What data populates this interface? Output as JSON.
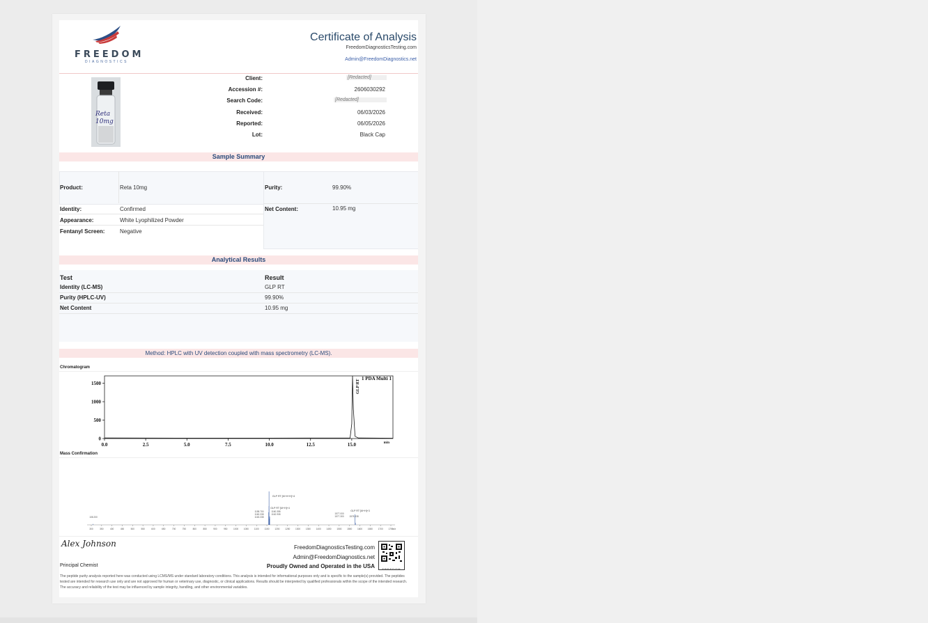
{
  "header": {
    "logo_word": "FREEDOM",
    "logo_sub": "DIAGNOSTICS",
    "title": "Certificate of Analysis",
    "website": "FreedomDiagnosticsTesting.com",
    "email": "Admin@FreedomDiagnostics.net"
  },
  "vial": {
    "label": "Reta 10mg"
  },
  "meta": [
    {
      "label": "Client:",
      "value": "[Redacted]",
      "redacted": true
    },
    {
      "label": "Accession #:",
      "value": "2606030292",
      "redacted": false
    },
    {
      "label": "Search Code:",
      "value": "[Redacted]",
      "redacted": true
    },
    {
      "label": "Received:",
      "value": "06/03/2026",
      "redacted": false
    },
    {
      "label": "Reported:",
      "value": "06/05/2026",
      "redacted": false
    },
    {
      "label": "Lot:",
      "value": "Black Cap",
      "redacted": false
    }
  ],
  "sample_summary": {
    "heading": "Sample Summary",
    "product_label": "Product:",
    "product": "Reta 10mg",
    "purity_label": "Purity:",
    "purity": "99.90%",
    "identity_label": "Identity:",
    "identity": "Confirmed",
    "net_label": "Net Content:",
    "net": "10.95 mg",
    "appearance_label": "Appearance:",
    "appearance": "White Lyophilized Powder",
    "fentanyl_label": "Fentanyl Screen:",
    "fentanyl": "Negative"
  },
  "analytical": {
    "heading": "Analytical Results",
    "col_test": "Test",
    "col_result": "Result",
    "rows": [
      {
        "test": "Identity (LC-MS)",
        "result": "GLP RT"
      },
      {
        "test": "Purity (HPLC-UV)",
        "result": "99.90%"
      },
      {
        "test": "Net Content",
        "result": "10.95 mg"
      }
    ]
  },
  "method": "Method: HPLC with UV detection coupled with mass spectrometry (LC-MS).",
  "chromatogram": {
    "label": "Chromatogram",
    "detector_label": "1 PDA Multi 1",
    "peak_label": "GLP RT"
  },
  "mass": {
    "label": "Mass Confirmation",
    "ion_labels": [
      "GLP RT [M+H+H]+4",
      "GLP RT [M+H]+4",
      "GLP RT [M+H]+3"
    ],
    "peak_labels": [
      "1158.700",
      "1160.338",
      "1163.338",
      "1160.358",
      "1162.908",
      "1577.000",
      "1577.300",
      "1578.438",
      "108.200"
    ],
    "axis_unit": "m/z"
  },
  "chart_data": [
    {
      "type": "line",
      "title": "",
      "xlabel": "min",
      "ylabel": "",
      "xlim": [
        0,
        17.5
      ],
      "ylim": [
        0,
        1700
      ],
      "xticks": [
        "0.0",
        "2.5",
        "5.0",
        "7.5",
        "10.0",
        "12.5",
        "15.0"
      ],
      "yticks": [
        "0",
        "500",
        "1000",
        "1500"
      ],
      "series": [
        {
          "name": "1 PDA Multi 1",
          "x": [
            0.0,
            5.0,
            10.0,
            14.9,
            15.0,
            15.05,
            15.1,
            15.2,
            15.4,
            17.5
          ],
          "y": [
            15,
            12,
            12,
            15,
            400,
            1700,
            800,
            60,
            15,
            10
          ]
        }
      ]
    },
    {
      "type": "bar",
      "title": "",
      "xlabel": "m/z",
      "ylabel": "",
      "xlim": [
        300,
        1750
      ],
      "ylim": [
        0,
        100
      ],
      "xticks": [
        "300",
        "350",
        "400",
        "450",
        "500",
        "550",
        "600",
        "650",
        "700",
        "750",
        "800",
        "850",
        "900",
        "950",
        "1000",
        "1050",
        "1100",
        "1150",
        "1200",
        "1250",
        "1300",
        "1350",
        "1400",
        "1450",
        "1500",
        "1550",
        "1600",
        "1650",
        "1700",
        "1750"
      ],
      "x": [
        308.2,
        1158.7,
        1160.338,
        1163.338,
        1160.358,
        1162.908,
        1577.0,
        1578.438
      ],
      "values": [
        2,
        30,
        80,
        20,
        45,
        15,
        25,
        5
      ]
    }
  ],
  "footer": {
    "signature": "Alex Johnson",
    "role": "Principal Chemist",
    "website": "FreedomDiagnosticsTesting.com",
    "email": "Admin@FreedomDiagnostics.net",
    "tagline": "Proudly Owned and Operated in the USA",
    "qr_caption": "FREEDOM",
    "disclaimer": "The peptide purity analysis reported here was conducted using LCMS/MS under standard laboratory conditions. This analysis is intended for informational purposes only and is specific to the sample(s) provided. The peptides tested are intended for research use only and are not approved for human or veterinary use, diagnostic, or clinical applications. Results should be interpreted by qualified professionals within the scope of the intended research. The accuracy and reliability of the test may be influenced by sample integrity, handling, and other environmental variables."
  }
}
